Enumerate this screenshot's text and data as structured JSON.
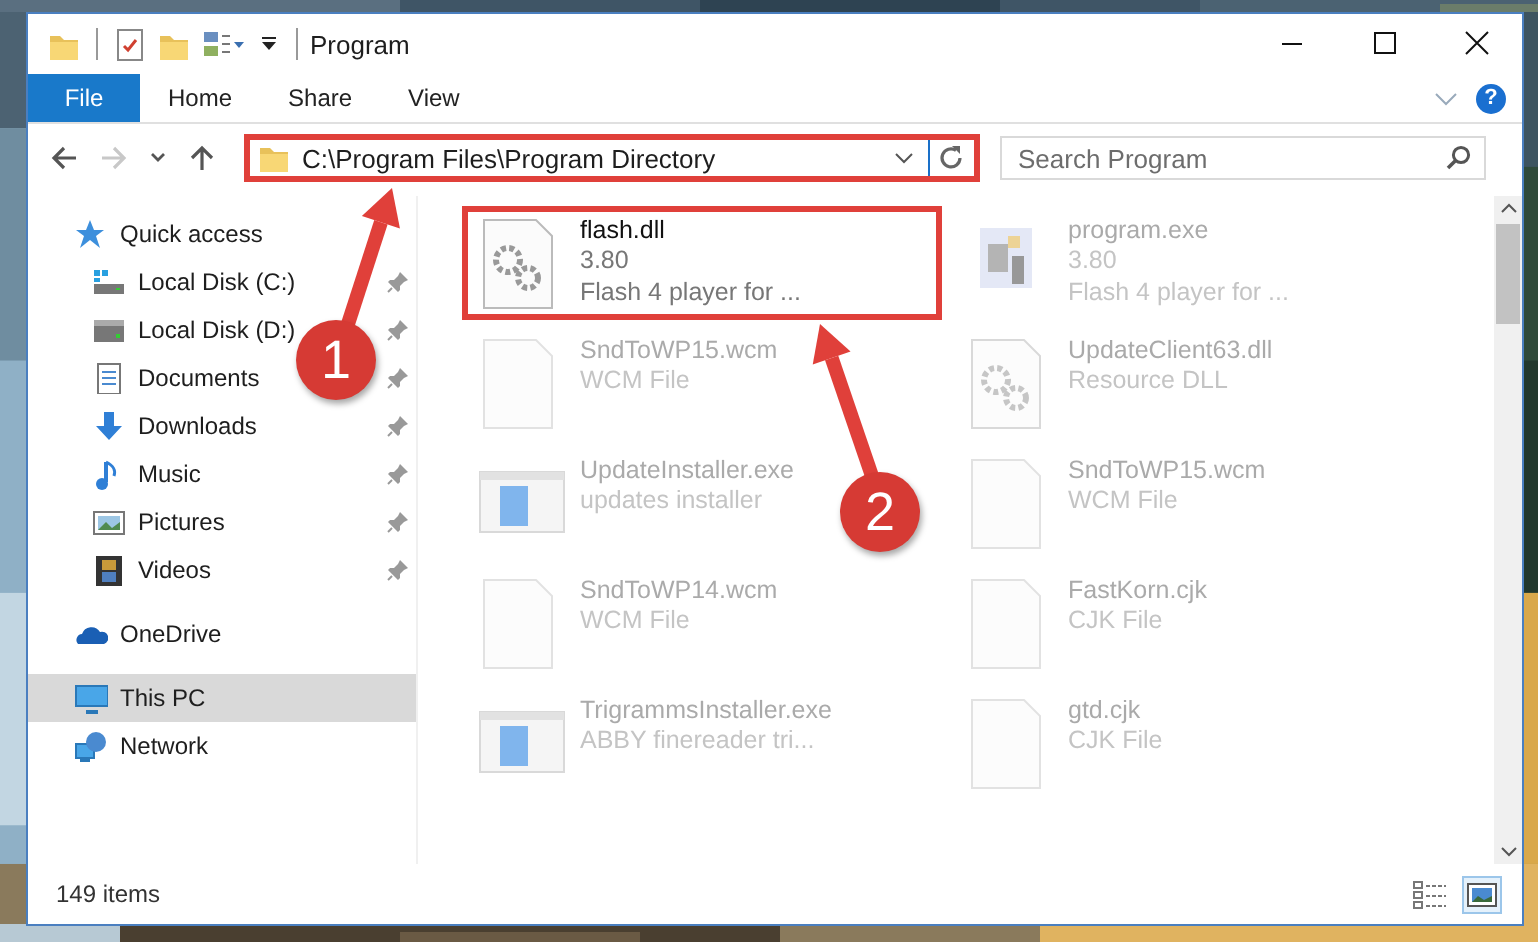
{
  "window": {
    "title": "Program"
  },
  "quick_access_toolbar": [
    {
      "kind": "folder"
    },
    {
      "kind": "properties"
    },
    {
      "kind": "new-folder"
    },
    {
      "kind": "view-menu"
    },
    {
      "kind": "customize"
    }
  ],
  "tabs": [
    {
      "label": "File",
      "kind": "file"
    },
    {
      "label": "Home",
      "kind": "tab"
    },
    {
      "label": "Share",
      "kind": "tab"
    },
    {
      "label": "View",
      "kind": "tab"
    }
  ],
  "help": "?",
  "nav_buttons": [
    {
      "kind": "back",
      "disabled": false
    },
    {
      "kind": "forward",
      "disabled": true
    },
    {
      "kind": "recent",
      "disabled": false
    },
    {
      "kind": "up",
      "disabled": false
    }
  ],
  "address": {
    "path": "C:\\Program Files\\Program Directory",
    "highlighted": true
  },
  "search": {
    "placeholder": "Search Program"
  },
  "sidebar": {
    "items": [
      {
        "label": "Quick access",
        "kind": "star",
        "selected": false,
        "children": [
          {
            "label": "Local Disk (C:)",
            "kind": "system-drive",
            "pinned": true,
            "selected": false
          },
          {
            "label": "Local Disk (D:)",
            "kind": "drive",
            "pinned": true,
            "selected": false
          },
          {
            "label": "Documents",
            "kind": "documents",
            "pinned": true,
            "selected": false
          },
          {
            "label": "Downloads",
            "kind": "downloads",
            "pinned": true,
            "selected": false
          },
          {
            "label": "Music",
            "kind": "music",
            "pinned": true,
            "selected": false
          },
          {
            "label": "Pictures",
            "kind": "pictures",
            "pinned": true,
            "selected": false
          },
          {
            "label": "Videos",
            "kind": "videos",
            "pinned": true,
            "selected": false
          }
        ]
      },
      {
        "label": "OneDrive",
        "kind": "cloud",
        "selected": false
      },
      {
        "label": "This PC",
        "kind": "pc",
        "selected": true
      },
      {
        "label": "Network",
        "kind": "network",
        "selected": false
      }
    ]
  },
  "files": [
    {
      "name": "flash.dll",
      "details": [
        "3.80",
        "Flash 4 player for ..."
      ],
      "kind": "gear-file",
      "highlighted": true,
      "dimmed": false
    },
    {
      "name": "program.exe",
      "details": [
        "3.80",
        "Flash 4 player for ..."
      ],
      "kind": "program",
      "highlighted": false,
      "dimmed": true
    },
    {
      "name": "SndToWP15.wcm",
      "details": [
        "WCM File"
      ],
      "kind": "blank-file",
      "highlighted": false,
      "dimmed": true
    },
    {
      "name": "UpdateClient63.dll",
      "details": [
        "Resource DLL"
      ],
      "kind": "gear-file",
      "highlighted": false,
      "dimmed": true
    },
    {
      "name": "UpdateInstaller.exe",
      "details": [
        "updates installer"
      ],
      "kind": "installer",
      "highlighted": false,
      "dimmed": true
    },
    {
      "name": "SndToWP15.wcm",
      "details": [
        "WCM File"
      ],
      "kind": "blank-file",
      "highlighted": false,
      "dimmed": true
    },
    {
      "name": "SndToWP14.wcm",
      "details": [
        "WCM File"
      ],
      "kind": "blank-file",
      "highlighted": false,
      "dimmed": true
    },
    {
      "name": "FastKorn.cjk",
      "details": [
        "CJK File"
      ],
      "kind": "blank-file",
      "highlighted": false,
      "dimmed": true
    },
    {
      "name": "TrigrammsInstaller.exe",
      "details": [
        "ABBY finereader tri..."
      ],
      "kind": "installer",
      "highlighted": false,
      "dimmed": true
    },
    {
      "name": "gtd.cjk",
      "details": [
        "CJK File"
      ],
      "kind": "blank-file",
      "highlighted": false,
      "dimmed": true
    }
  ],
  "status_bar": {
    "count": "149 items",
    "views": [
      {
        "kind": "details",
        "selected": false
      },
      {
        "kind": "tiles",
        "selected": true
      }
    ]
  },
  "annotations": [
    {
      "label": "1"
    },
    {
      "label": "2"
    }
  ]
}
